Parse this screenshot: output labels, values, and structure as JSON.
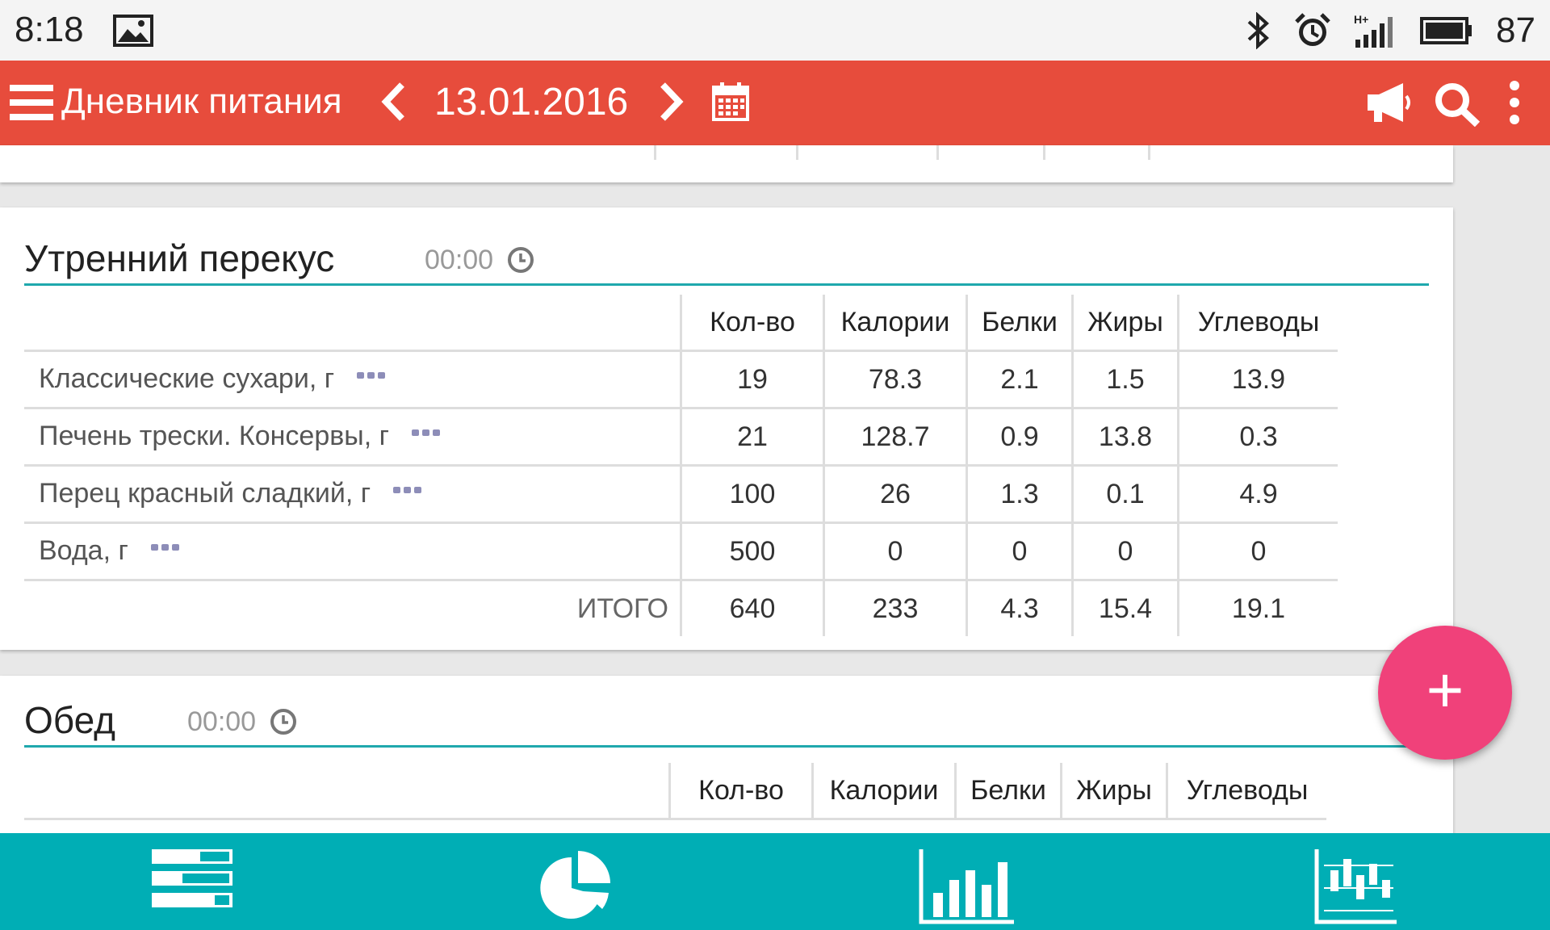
{
  "status_bar": {
    "time": "8:18",
    "battery": "87",
    "icons": [
      "image-icon",
      "bluetooth-icon",
      "alarm-icon",
      "signal-hplus-icon",
      "battery-icon"
    ]
  },
  "app_bar": {
    "title": "Дневник питания",
    "date": "13.01.2016",
    "icons": [
      "menu-icon",
      "chevron-left-icon",
      "chevron-right-icon",
      "calendar-icon",
      "megaphone-icon",
      "search-icon",
      "more-vert-icon"
    ]
  },
  "columns": [
    "Кол-во",
    "Калории",
    "Белки",
    "Жиры",
    "Углеводы"
  ],
  "morning_snack": {
    "title": "Утренний перекус",
    "time": "00:00",
    "rows": [
      {
        "name": "Классические сухари, г",
        "values": [
          "19",
          "78.3",
          "2.1",
          "1.5",
          "13.9"
        ]
      },
      {
        "name": "Печень трески. Консервы, г",
        "values": [
          "21",
          "128.7",
          "0.9",
          "13.8",
          "0.3"
        ]
      },
      {
        "name": "Перец красный сладкий, г",
        "values": [
          "100",
          "26",
          "1.3",
          "0.1",
          "4.9"
        ]
      },
      {
        "name": "Вода, г",
        "values": [
          "500",
          "0",
          "0",
          "0",
          "0"
        ]
      }
    ],
    "total_label": "ИТОГО",
    "total": [
      "640",
      "233",
      "4.3",
      "15.4",
      "19.1"
    ]
  },
  "lunch": {
    "title": "Обед",
    "time": "00:00"
  },
  "fab": {
    "label": "+"
  },
  "bottom_nav": [
    "diary-icon",
    "pie-chart-icon",
    "bar-chart-icon",
    "candlestick-chart-icon"
  ],
  "colors": {
    "app_bar": "#e74c3c",
    "accent": "#1fa8ad",
    "bottom_nav": "#00aeb5",
    "fab": "#f0417a"
  }
}
